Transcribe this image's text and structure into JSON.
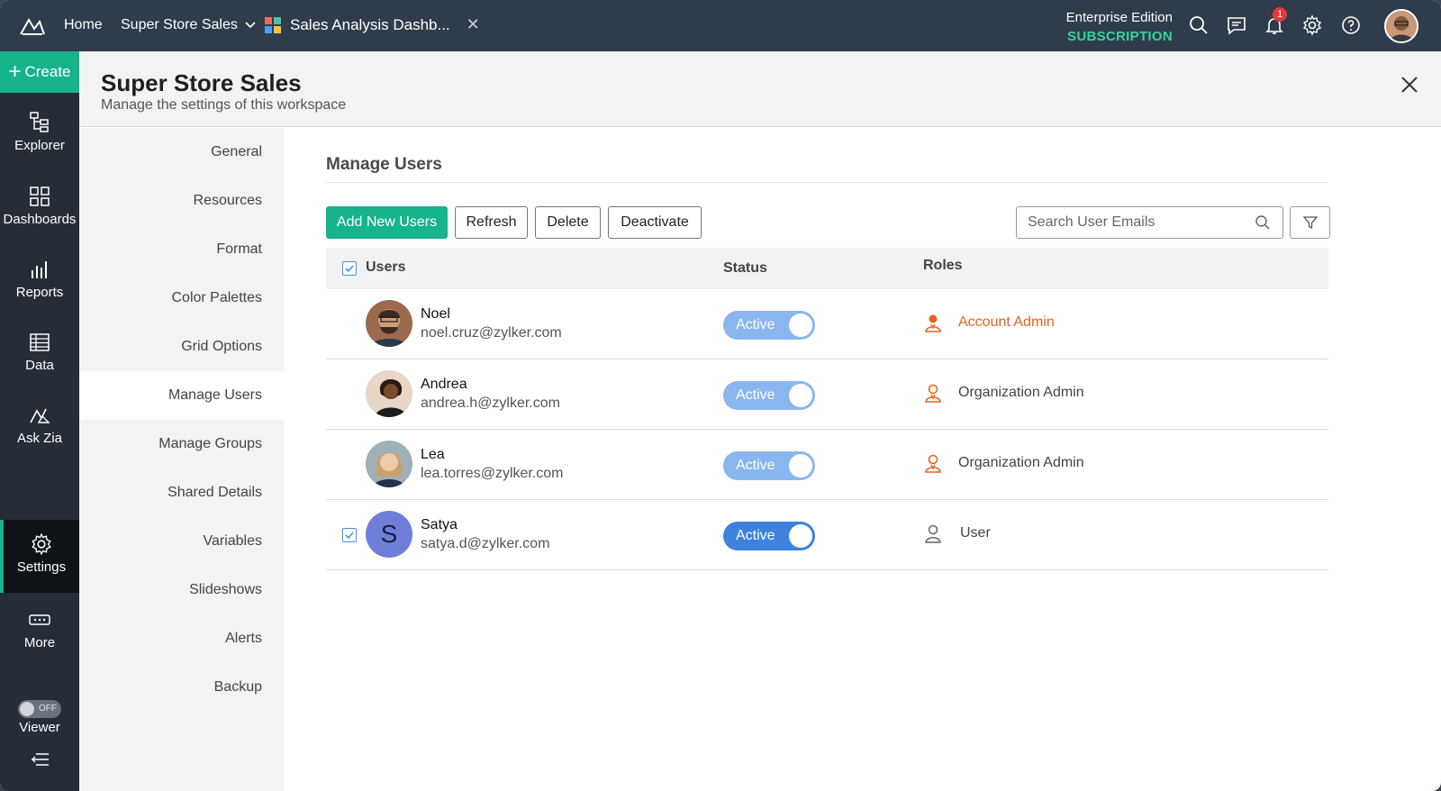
{
  "topbar": {
    "home": "Home",
    "workspace": "Super Store Sales",
    "tab": "Sales Analysis Dashb...",
    "edition": "Enterprise Edition",
    "subscription": "SUBSCRIPTION",
    "notification_count": "1"
  },
  "rail": {
    "create": "Create",
    "items": [
      "Explorer",
      "Dashboards",
      "Reports",
      "Data",
      "Ask Zia",
      "Settings",
      "More"
    ],
    "toggle": "OFF",
    "viewer": "Viewer"
  },
  "page": {
    "title": "Super Store Sales",
    "subtitle": "Manage the settings of this workspace"
  },
  "settings_nav": [
    "General",
    "Resources",
    "Format",
    "Color Palettes",
    "Grid Options",
    "Manage Users",
    "Manage Groups",
    "Shared Details",
    "Variables",
    "Slideshows",
    "Alerts",
    "Backup"
  ],
  "manage_users": {
    "title": "Manage Users",
    "buttons": {
      "add": "Add New Users",
      "refresh": "Refresh",
      "delete": "Delete",
      "deactivate": "Deactivate"
    },
    "search_placeholder": "Search User Emails",
    "columns": {
      "users": "Users",
      "status": "Status",
      "roles": "Roles"
    },
    "users": [
      {
        "name": "Noel",
        "email": "noel.cruz@zylker.com",
        "status": "Active",
        "role": "Account Admin"
      },
      {
        "name": "Andrea",
        "email": "andrea.h@zylker.com",
        "status": "Active",
        "role": "Organization Admin"
      },
      {
        "name": "Lea",
        "email": "lea.torres@zylker.com",
        "status": "Active",
        "role": "Organization Admin"
      },
      {
        "name": "Satya",
        "email": "satya.d@zylker.com",
        "status": "Active",
        "role": "User",
        "initial": "S"
      }
    ]
  },
  "colors": {
    "accent": "#16b38c",
    "topbar": "#2f3c4c",
    "rail": "#252d38",
    "role_admin": "#e8621c",
    "toggle": "#3e82dd"
  }
}
